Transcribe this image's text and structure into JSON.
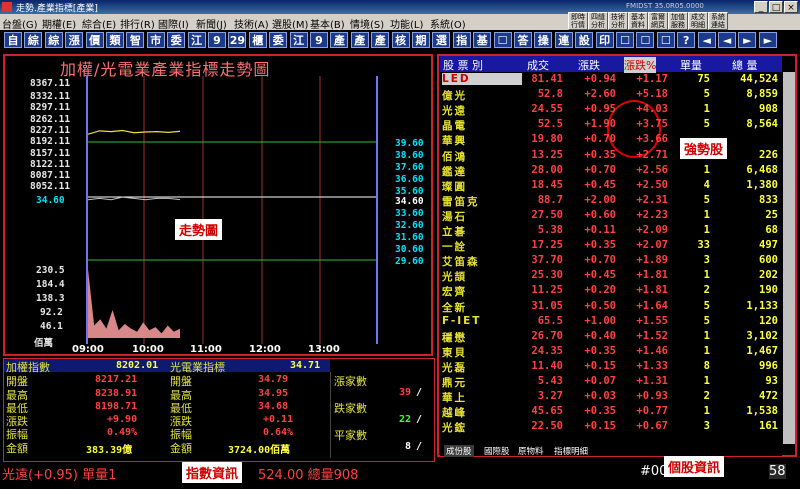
{
  "window": {
    "title": "走勢.產業指標[產業]",
    "version": "FMIDST 35.0R05.0000",
    "controls": [
      "_",
      "□",
      "×"
    ]
  },
  "menu": [
    "台盤(G)",
    "期權(E)",
    "綜合(E)",
    "排行(R)",
    "國際(I)",
    "新聞(J)",
    "技術(A)",
    "選股(M)",
    "基本(B)",
    "情境(S)",
    "功能(L)",
    "系統(O)"
  ],
  "quick_buttons": [
    "即時行情",
    "四縫分析",
    "技術分析",
    "基本資料",
    "富爾網頁",
    "加值服務",
    "成交明細",
    "系統連結"
  ],
  "toolbar": [
    "自",
    "綜",
    "綜",
    "漲",
    "價",
    "類",
    "智",
    "市",
    "委",
    "江",
    "9",
    "29",
    "櫃",
    "委",
    "江",
    "9",
    "產",
    "產",
    "產",
    "核",
    "期",
    "選",
    "指",
    "基",
    "☐",
    "答",
    "操",
    "連",
    "設",
    "印",
    "☐",
    "☐",
    "☐",
    "?",
    "◄",
    "◄",
    "►",
    "►"
  ],
  "chart": {
    "title": "加權/光電業產業指標走勢圖",
    "y_left_upper": [
      "8367.11",
      "8332.11",
      "8297.11",
      "8262.11",
      "8227.11",
      "8192.11",
      "8157.11",
      "8122.11",
      "8087.11",
      "8052.11"
    ],
    "y_left_mid": "34.60",
    "y_left_lower": [
      "230.5",
      "184.4",
      "138.3",
      "92.2",
      "46.1"
    ],
    "y_left_unit": "佰萬",
    "y_right": [
      "39.60",
      "38.60",
      "37.60",
      "36.60",
      "35.60",
      "34.60",
      "33.60",
      "32.60",
      "31.60",
      "30.60",
      "29.60"
    ],
    "x_labels": [
      "09:00",
      "10:00",
      "11:00",
      "12:00",
      "13:00"
    ]
  },
  "chart_data": {
    "type": "line",
    "x_labels": [
      "09:00",
      "10:00",
      "11:00",
      "12:00",
      "13:00"
    ],
    "series": [
      {
        "name": "加權",
        "values": [
          8217.21,
          8226.0,
          8224.0,
          8227.0,
          8221.0,
          8223.0,
          8224.0,
          8222.0,
          8225.0
        ]
      },
      {
        "name": "光電業",
        "values": [
          34.7,
          34.8,
          34.7,
          34.9,
          34.8,
          34.7,
          34.8,
          34.8,
          34.71
        ]
      },
      {
        "name": "成交量",
        "values": [
          220,
          40,
          60,
          30,
          90,
          25,
          45,
          30,
          20,
          50,
          25,
          35,
          15,
          40,
          20,
          30
        ]
      }
    ],
    "ylim_index": [
      8052.11,
      8367.11
    ],
    "ylim_sector": [
      29.6,
      39.6
    ],
    "ylim_volume": [
      0,
      230.5
    ]
  },
  "notes": {
    "trend": "走勢圖",
    "strong": "強勢股",
    "index_info": "指數資訊",
    "stock_info": "個股資訊"
  },
  "index_panel": {
    "weighted": {
      "name": "加權指數",
      "value": "8202.01",
      "rows": [
        {
          "label": "開盤",
          "value": "8217.21"
        },
        {
          "label": "最高",
          "value": "8238.91"
        },
        {
          "label": "最低",
          "value": "8198.71"
        },
        {
          "label": "漲跌",
          "value": "+9.90"
        },
        {
          "label": "振幅",
          "value": "0.49%"
        },
        {
          "label": "金額",
          "value": "383.39億"
        }
      ]
    },
    "sector": {
      "name": "光電業指標",
      "value": "34.71",
      "rows": [
        {
          "label": "開盤",
          "value": "34.79"
        },
        {
          "label": "最高",
          "value": "34.95"
        },
        {
          "label": "最低",
          "value": "34.68"
        },
        {
          "label": "漲跌",
          "value": "+0.11"
        },
        {
          "label": "振幅",
          "value": "0.64%"
        },
        {
          "label": "金額",
          "value": "3724.00佰萬"
        }
      ]
    },
    "breadth": [
      {
        "label": "漲家數",
        "a": "39",
        "b": "/"
      },
      {
        "label": "跌家數",
        "a": "22",
        "b": "/"
      },
      {
        "label": "平家數",
        "a": "8",
        "b": "/"
      }
    ]
  },
  "stock_table": {
    "headers": [
      "股 票 別",
      "成交",
      "漲跌",
      "漲跌%",
      "單量",
      "總 量"
    ],
    "rows": [
      {
        "name": "LED",
        "price": "81.41",
        "chg": "+0.94",
        "pct": "+1.17",
        "vol": "75",
        "total": "44,524"
      },
      {
        "name": "億光",
        "price": "52.8",
        "chg": "+2.60",
        "pct": "+5.18",
        "vol": "5",
        "total": "8,859"
      },
      {
        "name": "光遠",
        "price": "24.55",
        "chg": "+0.95",
        "pct": "+4.03",
        "vol": "1",
        "total": "908"
      },
      {
        "name": "晶電",
        "price": "52.5",
        "chg": "+1.90",
        "pct": "+3.75",
        "vol": "5",
        "total": "8,564"
      },
      {
        "name": "華興",
        "price": "19.80",
        "chg": "+0.70",
        "pct": "+3.66",
        "vol": "",
        "total": ""
      },
      {
        "name": "佰鴻",
        "price": "13.25",
        "chg": "+0.35",
        "pct": "+2.71",
        "vol": "",
        "total": "226"
      },
      {
        "name": "鑑達",
        "price": "28.00",
        "chg": "+0.70",
        "pct": "+2.56",
        "vol": "1",
        "total": "6,468"
      },
      {
        "name": "璨圓",
        "price": "18.45",
        "chg": "+0.45",
        "pct": "+2.50",
        "vol": "4",
        "total": "1,380"
      },
      {
        "name": "雷笛克",
        "price": "88.7",
        "chg": "+2.00",
        "pct": "+2.31",
        "vol": "5",
        "total": "833"
      },
      {
        "name": "湯石",
        "price": "27.50",
        "chg": "+0.60",
        "pct": "+2.23",
        "vol": "1",
        "total": "25"
      },
      {
        "name": "立碁",
        "price": "5.38",
        "chg": "+0.11",
        "pct": "+2.09",
        "vol": "1",
        "total": "68"
      },
      {
        "name": "一詮",
        "price": "17.25",
        "chg": "+0.35",
        "pct": "+2.07",
        "vol": "33",
        "total": "497"
      },
      {
        "name": "艾笛森",
        "price": "37.70",
        "chg": "+0.70",
        "pct": "+1.89",
        "vol": "3",
        "total": "600"
      },
      {
        "name": "光頡",
        "price": "25.30",
        "chg": "+0.45",
        "pct": "+1.81",
        "vol": "1",
        "total": "202"
      },
      {
        "name": "宏齊",
        "price": "11.25",
        "chg": "+0.20",
        "pct": "+1.81",
        "vol": "2",
        "total": "190"
      },
      {
        "name": "全新",
        "price": "31.05",
        "chg": "+0.50",
        "pct": "+1.64",
        "vol": "5",
        "total": "1,133"
      },
      {
        "name": "F-IET",
        "price": "65.5",
        "chg": "+1.00",
        "pct": "+1.55",
        "vol": "5",
        "total": "120"
      },
      {
        "name": "穩懋",
        "price": "26.70",
        "chg": "+0.40",
        "pct": "+1.52",
        "vol": "1",
        "total": "3,102"
      },
      {
        "name": "東貝",
        "price": "24.35",
        "chg": "+0.35",
        "pct": "+1.46",
        "vol": "1",
        "total": "1,467"
      },
      {
        "name": "光磊",
        "price": "11.40",
        "chg": "+0.15",
        "pct": "+1.33",
        "vol": "8",
        "total": "996"
      },
      {
        "name": "鼎元",
        "price": "5.43",
        "chg": "+0.07",
        "pct": "+1.31",
        "vol": "1",
        "total": "93"
      },
      {
        "name": "華上",
        "price": "3.27",
        "chg": "+0.03",
        "pct": "+0.93",
        "vol": "2",
        "total": "472"
      },
      {
        "name": "越峰",
        "price": "45.65",
        "chg": "+0.35",
        "pct": "+0.77",
        "vol": "1",
        "total": "1,538"
      },
      {
        "name": "光鋐",
        "price": "22.50",
        "chg": "+0.15",
        "pct": "+0.67",
        "vol": "3",
        "total": "161"
      }
    ],
    "tabs": [
      "成份股",
      "國際股",
      "原物料",
      "指標明細"
    ]
  },
  "status": {
    "left": "光遠(+0.95) 單量1",
    "mid": "524.00 總量908",
    "right_a": "#00",
    "right_b": "58"
  }
}
